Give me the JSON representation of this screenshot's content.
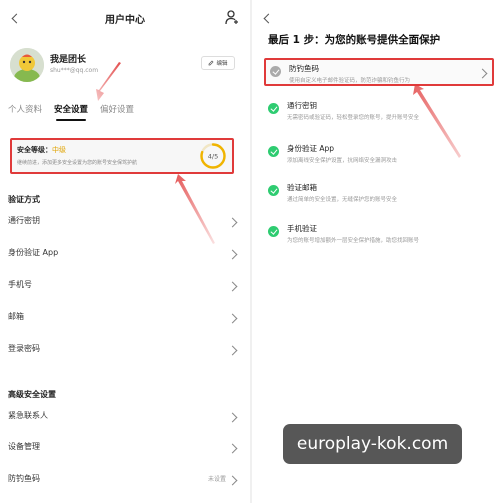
{
  "left": {
    "title": "用户中心",
    "user": {
      "name": "我是团长",
      "email": "shu***@qq.com",
      "edit_label": "编辑"
    },
    "tabs": [
      {
        "label": "个人资料"
      },
      {
        "label": "安全设置",
        "active": true
      },
      {
        "label": "偏好设置"
      }
    ],
    "security_card": {
      "prefix": "安全等级：",
      "level": "中级",
      "desc": "继续前进，添加更多安全设置为您的账号安全保驾护航",
      "score": "4/5",
      "progress": 0.8
    },
    "verify_section": {
      "title": "验证方式",
      "items": [
        {
          "label": "通行密钥"
        },
        {
          "label": "身份验证 App"
        },
        {
          "label": "手机号"
        },
        {
          "label": "邮箱"
        },
        {
          "label": "登录密码"
        }
      ]
    },
    "advanced_section": {
      "title": "高级安全设置",
      "items": [
        {
          "label": "紧急联系人",
          "trail": ""
        },
        {
          "label": "设备管理",
          "trail": ""
        },
        {
          "label": "防钓鱼码",
          "trail": "未设置"
        }
      ]
    }
  },
  "right": {
    "heading": "最后 1 步：为您的账号提供全面保护",
    "items": [
      {
        "title": "防钓鱼码",
        "desc": "使用自定义电子邮件验证码，防范诈骗和钓鱼行为",
        "status": "grey",
        "highlighted": true
      },
      {
        "title": "通行密钥",
        "desc": "无需密码或验证码，轻松登录您的账号，提升账号安全",
        "status": "green"
      },
      {
        "title": "身份验证 App",
        "desc": "添加离线安全保护设置，抗网络安全漏洞攻击",
        "status": "green"
      },
      {
        "title": "验证邮箱",
        "desc": "通过简单的安全设置，无缝保护您的账号安全",
        "status": "green"
      },
      {
        "title": "手机验证",
        "desc": "为您的账号增加额外一层安全保护措施，助您找回账号",
        "status": "green"
      }
    ]
  },
  "watermark": "europlay-kok.com",
  "colors": {
    "highlight": "#e03a3a",
    "success": "#2ecc71",
    "level": "#e0a300"
  }
}
